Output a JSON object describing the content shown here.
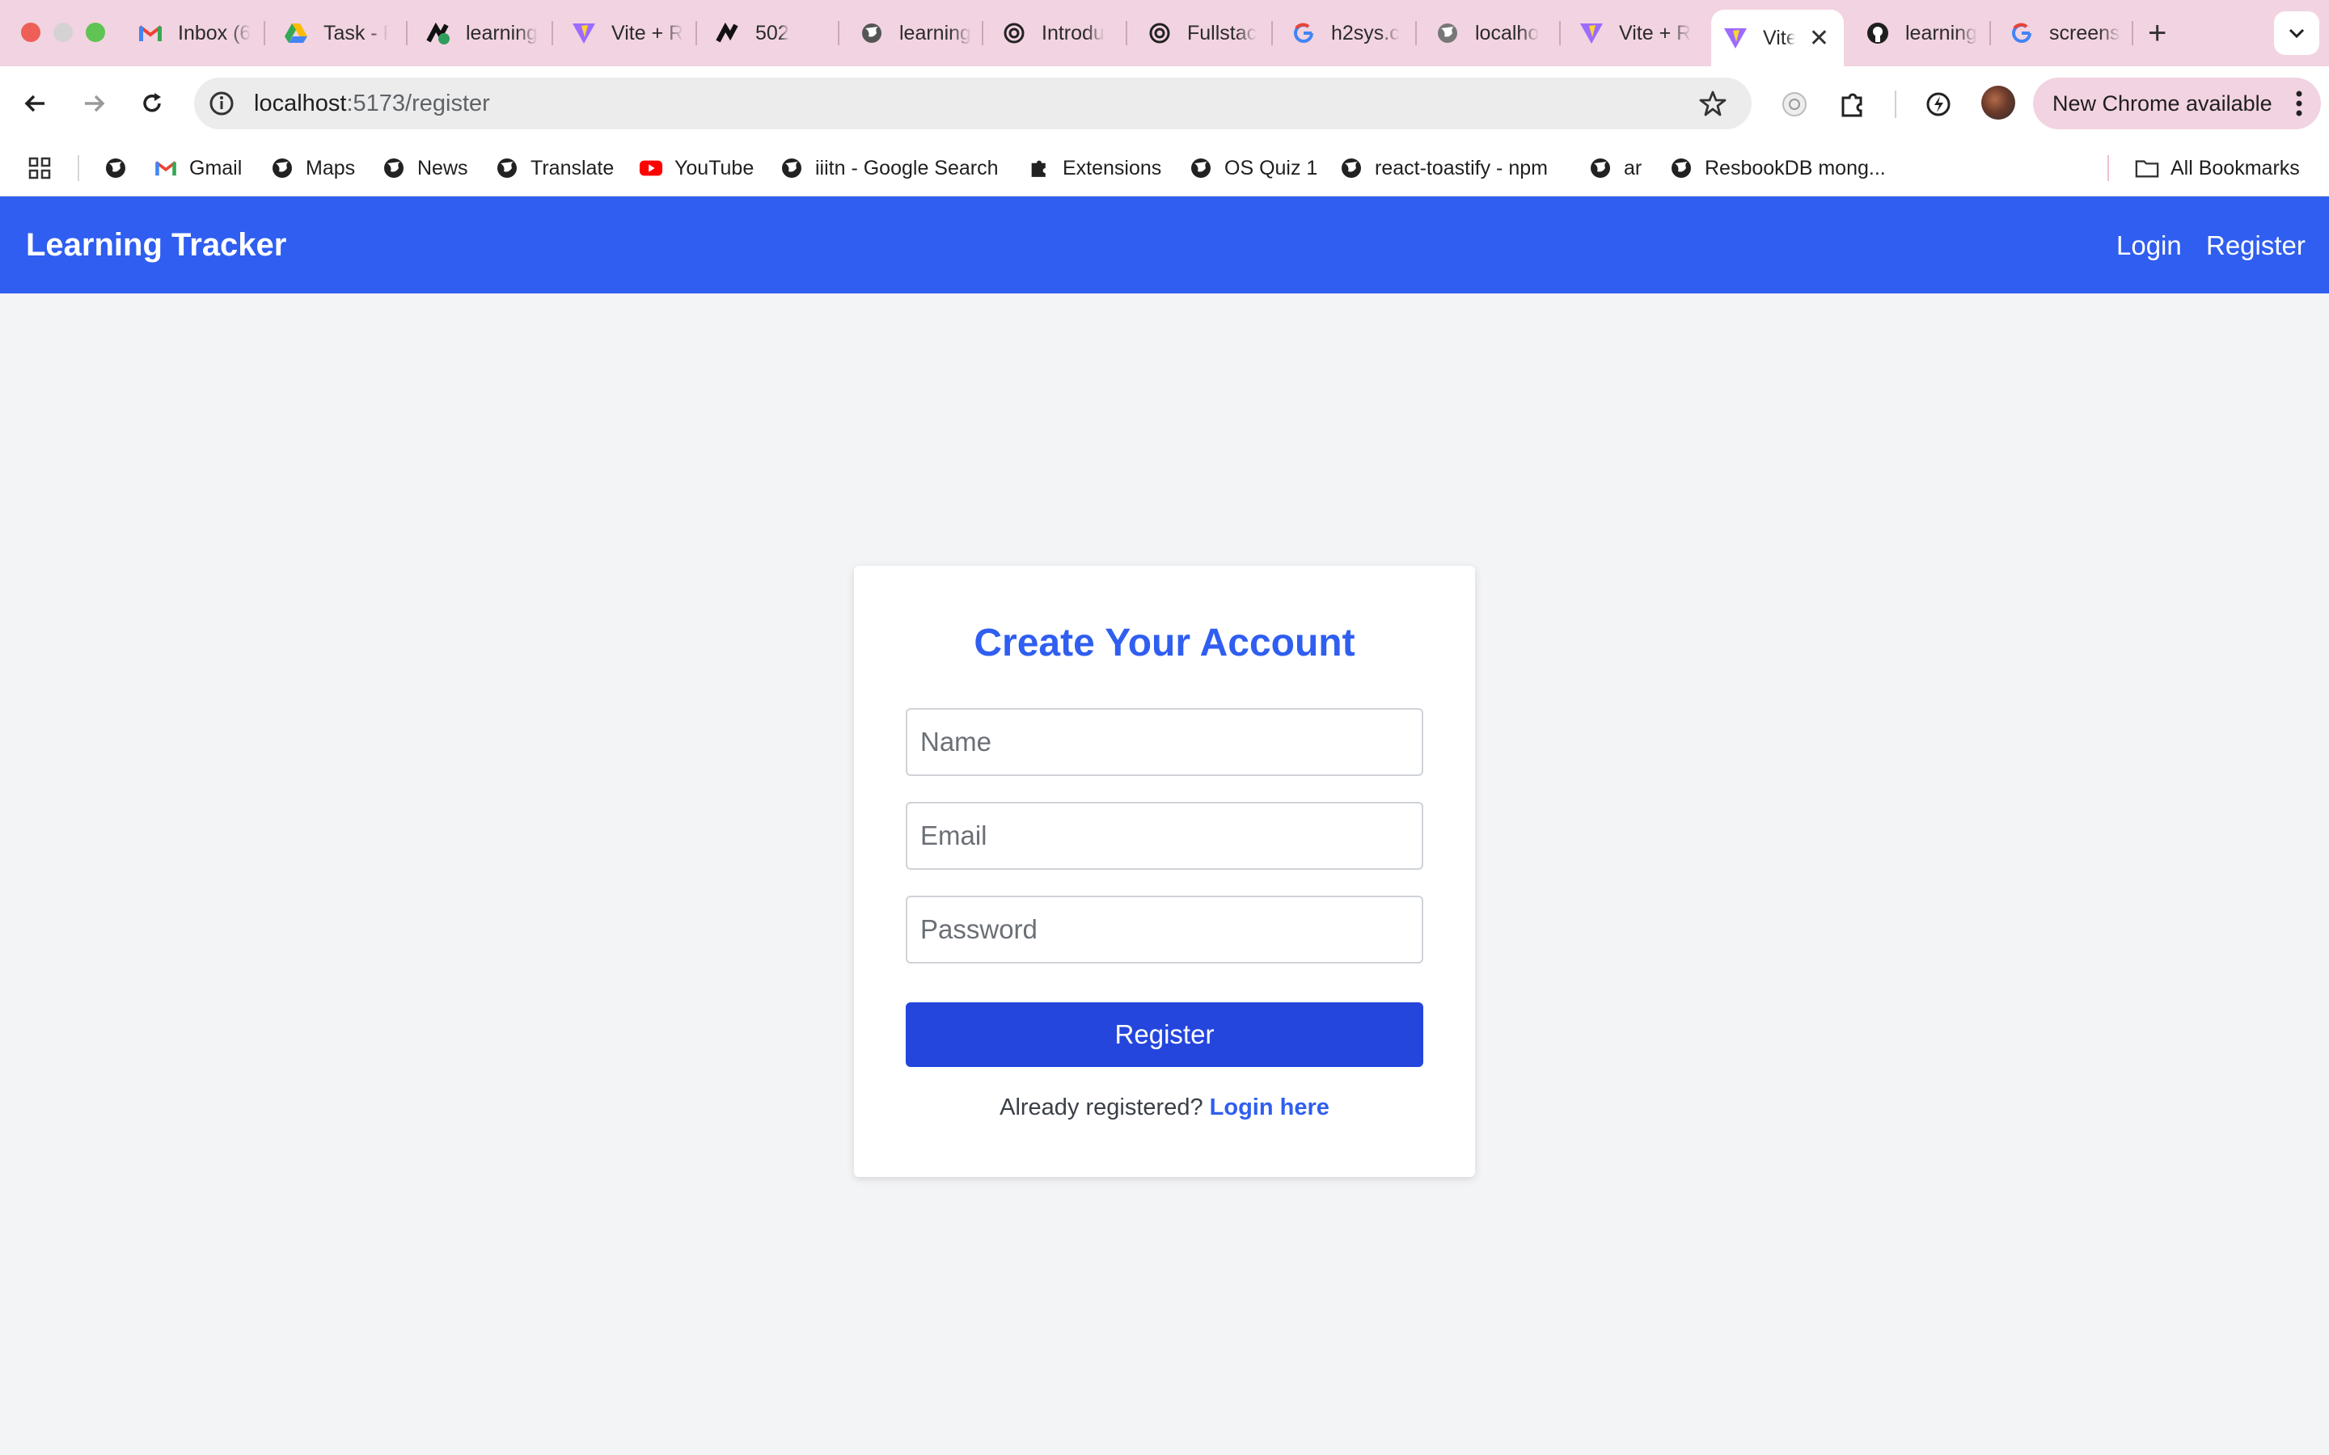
{
  "browser": {
    "tabs": [
      {
        "title": "Inbox (6",
        "icon": "gmail-icon"
      },
      {
        "title": "Task - F",
        "icon": "google-drive-icon"
      },
      {
        "title": "learning",
        "icon": "app-favicon-icon"
      },
      {
        "title": "Vite + R",
        "icon": "vite-icon"
      },
      {
        "title": "502",
        "icon": "app-favicon-icon"
      },
      {
        "title": "learning",
        "icon": "globe-icon"
      },
      {
        "title": "Introdu",
        "icon": "openai-icon"
      },
      {
        "title": "Fullstac",
        "icon": "openai-icon"
      },
      {
        "title": "h2sys.c",
        "icon": "google-icon"
      },
      {
        "title": "localho",
        "icon": "globe-icon"
      },
      {
        "title": "Vite + R",
        "icon": "vite-icon"
      },
      {
        "title": "Vite",
        "icon": "vite-icon",
        "active": true
      },
      {
        "title": "learning",
        "icon": "github-icon"
      },
      {
        "title": "screens",
        "icon": "google-icon"
      }
    ],
    "address": {
      "host": "localhost",
      "path": ":5173/register"
    },
    "update_label": "New Chrome available",
    "bookmarks": [
      {
        "label": "",
        "icon": "globe-icon"
      },
      {
        "label": "Gmail",
        "icon": "gmail-icon"
      },
      {
        "label": "Maps",
        "icon": "globe-icon"
      },
      {
        "label": "News",
        "icon": "globe-icon"
      },
      {
        "label": "Translate",
        "icon": "globe-icon"
      },
      {
        "label": "YouTube",
        "icon": "youtube-icon"
      },
      {
        "label": "iiitn - Google Search",
        "icon": "globe-icon"
      },
      {
        "label": "Extensions",
        "icon": "puzzle-icon"
      },
      {
        "label": "OS Quiz 1",
        "icon": "globe-icon"
      },
      {
        "label": "react-toastify - npm",
        "icon": "globe-icon"
      },
      {
        "label": "ar",
        "icon": "globe-icon"
      },
      {
        "label": "ResbookDB mong...",
        "icon": "globe-icon"
      }
    ],
    "all_bookmarks_label": "All Bookmarks"
  },
  "app": {
    "brand": "Learning Tracker",
    "nav": {
      "login": "Login",
      "register": "Register"
    },
    "colors": {
      "primary": "#2f5ef0",
      "button": "#2446dc",
      "background": "#f3f4f6"
    }
  },
  "form": {
    "title": "Create Your Account",
    "name_placeholder": "Name",
    "email_placeholder": "Email",
    "password_placeholder": "Password",
    "name_value": "",
    "email_value": "",
    "password_value": "",
    "submit_label": "Register",
    "footer_text": "Already registered?",
    "footer_link": "Login here"
  }
}
